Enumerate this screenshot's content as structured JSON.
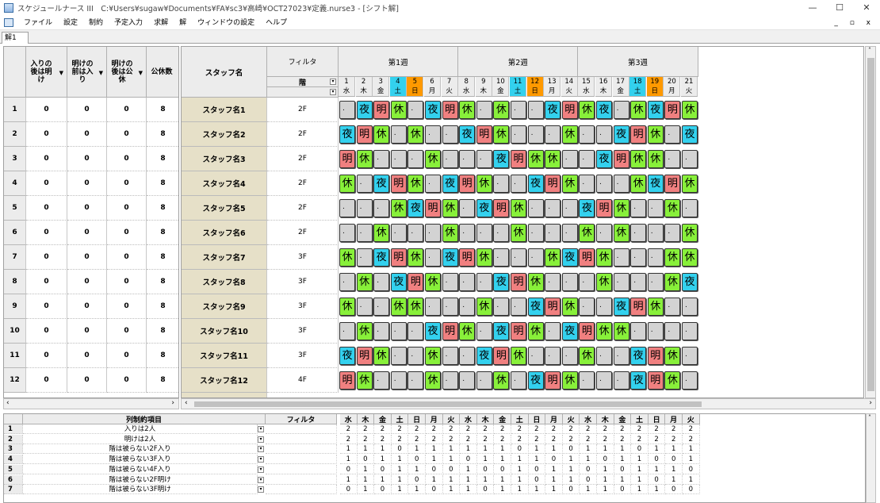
{
  "window": {
    "title": "スケジュールナース III　C:¥Users¥sugaw¥Documents¥FA¥sc3¥高崎¥OCT27023¥定義.nurse3 - [シフト解]",
    "min": "—",
    "max": "☐",
    "close": "✕"
  },
  "menu": [
    "ファイル",
    "設定",
    "制約",
    "予定入力",
    "求解",
    "解",
    "ウィンドウの設定",
    "ヘルプ"
  ],
  "mdi_controls": "_ ▫ x",
  "tab": "解1",
  "left_headers": [
    "入りの後は明け",
    "明けの前は入り",
    "明けの後は公休",
    "公休数"
  ],
  "staff_header": "スタッフ名",
  "filter_header": "フィルタ",
  "filter_sub": "階",
  "weeks": [
    "第1週",
    "第2週",
    "第3週"
  ],
  "days": {
    "nums": [
      "1",
      "2",
      "3",
      "4",
      "5",
      "6",
      "7",
      "8",
      "9",
      "10",
      "11",
      "12",
      "13",
      "14",
      "15",
      "16",
      "17",
      "18",
      "19",
      "20",
      "21"
    ],
    "wk": [
      "水",
      "木",
      "金",
      "土",
      "日",
      "月",
      "火",
      "水",
      "木",
      "金",
      "土",
      "日",
      "月",
      "火",
      "水",
      "木",
      "金",
      "土",
      "日",
      "月",
      "火"
    ]
  },
  "colors": {
    "sat": "#33d1ee",
    "sun": "#ff9900",
    "x": "#f08080",
    "y": "#33d1ee",
    "k": "#88f03a",
    "d": "#d3d3d3"
  },
  "staff": [
    {
      "no": "1",
      "name": "スタッフ名1",
      "floor": "2F",
      "c": [
        "0",
        "0",
        "0",
        "8"
      ],
      "s": "d y x k d y x k d k d d y x k y d k y x k"
    },
    {
      "no": "2",
      "name": "スタッフ名2",
      "floor": "2F",
      "c": [
        "0",
        "0",
        "0",
        "8"
      ],
      "s": "y x k d k d d y x k d d d k d d y x k d y"
    },
    {
      "no": "3",
      "name": "スタッフ名3",
      "floor": "2F",
      "c": [
        "0",
        "0",
        "0",
        "8"
      ],
      "s": "x k d d d k d d d y x k k d d y x k k d d"
    },
    {
      "no": "4",
      "name": "スタッフ名4",
      "floor": "2F",
      "c": [
        "0",
        "0",
        "0",
        "8"
      ],
      "s": "k d y x k d y x k d d y x k d d d k y x k"
    },
    {
      "no": "5",
      "name": "スタッフ名5",
      "floor": "2F",
      "c": [
        "0",
        "0",
        "0",
        "8"
      ],
      "s": "d d d k y x k d y x k d d d y x k d d k d"
    },
    {
      "no": "6",
      "name": "スタッフ名6",
      "floor": "2F",
      "c": [
        "0",
        "0",
        "0",
        "8"
      ],
      "s": "d d k d d d k d d d k d d d k d k d d d k"
    },
    {
      "no": "7",
      "name": "スタッフ名7",
      "floor": "3F",
      "c": [
        "0",
        "0",
        "0",
        "8"
      ],
      "s": "k d y x k d y x k d d d k y x k d d d k k"
    },
    {
      "no": "8",
      "name": "スタッフ名8",
      "floor": "3F",
      "c": [
        "0",
        "0",
        "0",
        "8"
      ],
      "s": "d k d y x k d d d y x k d d d k d d d k y"
    },
    {
      "no": "9",
      "name": "スタッフ名9",
      "floor": "3F",
      "c": [
        "0",
        "0",
        "0",
        "8"
      ],
      "s": "k d d k k d d d k d d y x k d d y x k d d"
    },
    {
      "no": "10",
      "name": "スタッフ名10",
      "floor": "3F",
      "c": [
        "0",
        "0",
        "0",
        "8"
      ],
      "s": "d k d d d y x k d y x k d y x k k d d d d"
    },
    {
      "no": "11",
      "name": "スタッフ名11",
      "floor": "3F",
      "c": [
        "0",
        "0",
        "0",
        "8"
      ],
      "s": "y x k d d k d d y x k d d d k d d y x k d"
    },
    {
      "no": "12",
      "name": "スタッフ名12",
      "floor": "4F",
      "c": [
        "0",
        "0",
        "0",
        "8"
      ],
      "s": "x k d d d k d d d k d y x k d d d y x k d"
    }
  ],
  "shift_labels": {
    "x": "明",
    "y": "夜",
    "k": "休",
    "d": "."
  },
  "bottom": {
    "header": "列制約項目",
    "filter": "フィルタ",
    "rows": [
      {
        "no": "1",
        "label": "入りは2人",
        "v": [
          "2",
          "2",
          "2",
          "2",
          "2",
          "2",
          "2",
          "2",
          "2",
          "2",
          "2",
          "2",
          "2",
          "2",
          "2",
          "2",
          "2",
          "2",
          "2",
          "2",
          "2"
        ]
      },
      {
        "no": "2",
        "label": "明けは2人",
        "v": [
          "2",
          "2",
          "2",
          "2",
          "2",
          "2",
          "2",
          "2",
          "2",
          "2",
          "2",
          "2",
          "2",
          "2",
          "2",
          "2",
          "2",
          "2",
          "2",
          "2",
          "2"
        ]
      },
      {
        "no": "3",
        "label": "階は被らない2F入り",
        "v": [
          "1",
          "1",
          "1",
          "0",
          "1",
          "1",
          "1",
          "1",
          "1",
          "1",
          "0",
          "1",
          "1",
          "0",
          "1",
          "1",
          "1",
          "0",
          "1",
          "1",
          "1"
        ]
      },
      {
        "no": "4",
        "label": "階は被らない3F入り",
        "v": [
          "1",
          "0",
          "1",
          "1",
          "0",
          "1",
          "1",
          "0",
          "1",
          "1",
          "1",
          "1",
          "0",
          "1",
          "1",
          "0",
          "1",
          "1",
          "0",
          "0",
          "1"
        ]
      },
      {
        "no": "5",
        "label": "階は被らない4F入り",
        "v": [
          "0",
          "1",
          "0",
          "1",
          "1",
          "0",
          "0",
          "1",
          "0",
          "0",
          "1",
          "0",
          "1",
          "1",
          "0",
          "1",
          "0",
          "1",
          "1",
          "1",
          "0"
        ]
      },
      {
        "no": "6",
        "label": "階は被らない2F明け",
        "v": [
          "1",
          "1",
          "1",
          "1",
          "0",
          "1",
          "1",
          "1",
          "1",
          "1",
          "1",
          "0",
          "1",
          "1",
          "0",
          "1",
          "1",
          "1",
          "0",
          "1",
          "1"
        ]
      },
      {
        "no": "7",
        "label": "階は被らない3F明け",
        "v": [
          "0",
          "1",
          "0",
          "1",
          "1",
          "0",
          "1",
          "1",
          "0",
          "1",
          "1",
          "1",
          "1",
          "0",
          "1",
          "1",
          "0",
          "1",
          "1",
          "0",
          "0"
        ]
      }
    ]
  }
}
